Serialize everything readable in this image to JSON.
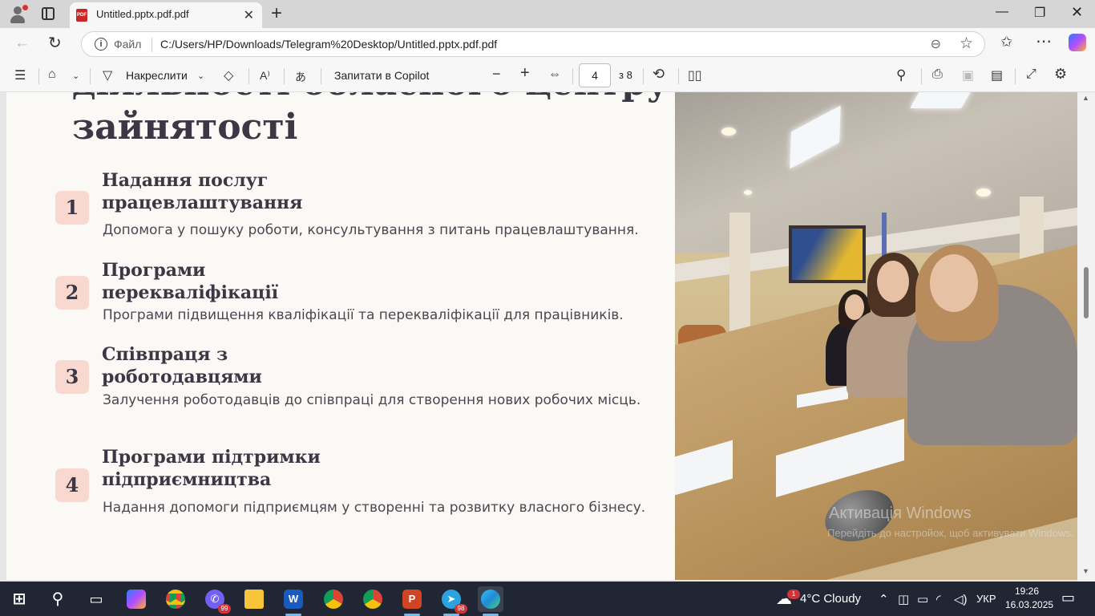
{
  "browser": {
    "tab_title": "Untitled.pptx.pdf.pdf",
    "address_prefix": "Файл",
    "address_url": "C:/Users/HP/Downloads/Telegram%20Desktop/Untitled.pptx.pdf.pdf"
  },
  "pdf_toolbar": {
    "draw_label": "Накреслити",
    "copilot_label": "Запитати в Copilot",
    "page_current": "4",
    "page_total": "з 8"
  },
  "slide": {
    "heading_cut": "діяльності обласного центру",
    "heading": "зайнятості",
    "items": [
      {
        "number": "1",
        "title": "Надання послуг працевлаштування",
        "desc": "Допомога у пошуку роботи, консультування з питань працевлаштування."
      },
      {
        "number": "2",
        "title": "Програми перекваліфікації",
        "desc": "Програми підвищення кваліфікації та перекваліфікації для працівників."
      },
      {
        "number": "3",
        "title": "Співпраця з роботодавцями",
        "desc": "Залучення роботодавців до співпраці для створення нових робочих місць."
      },
      {
        "number": "4",
        "title": "Програми підтримки підприємництва",
        "desc": "Надання допомоги підприємцям у створенні та розвитку власного бізнесу."
      }
    ],
    "watermark_line1": "Активація Windows",
    "watermark_line2": "Перейдіть до настройок, щоб активувати Windows."
  },
  "taskbar": {
    "viber_badge": "99",
    "telegram_badge": "98",
    "weather_badge": "1",
    "weather": "4°C  Cloudy",
    "language": "УКР",
    "time": "19:26",
    "date": "16.03.2025"
  }
}
